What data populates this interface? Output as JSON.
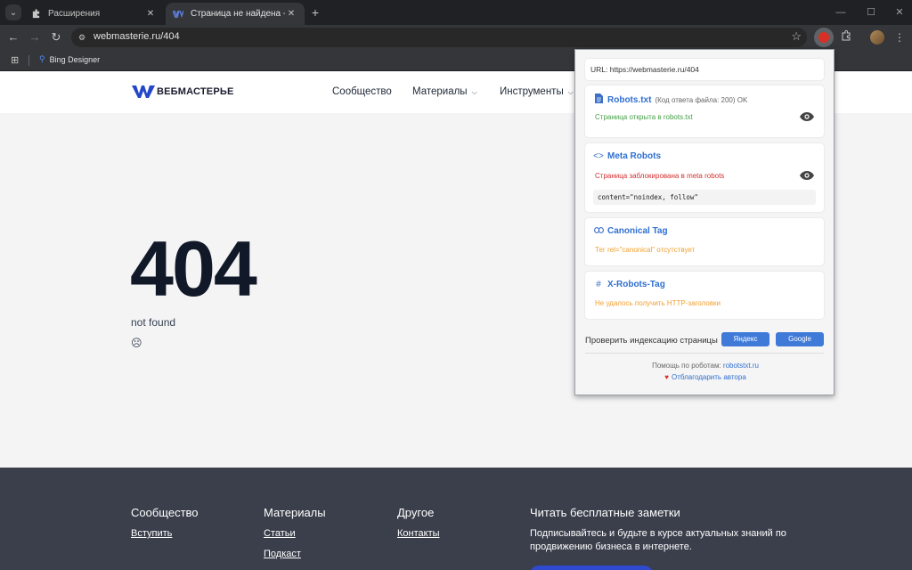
{
  "browser": {
    "tabs": [
      {
        "title": "Расширения",
        "icon": "puzzle-icon",
        "active": false
      },
      {
        "title": "Страница не найдена - Вебмастерье",
        "icon": "vm-favicon",
        "active": true
      }
    ],
    "omnibox": {
      "url": "webmasterie.ru/404"
    },
    "bookmarks": [
      {
        "label": "Bing Designer",
        "icon": "search-icon"
      }
    ],
    "toolbar_icons": [
      "back-icon",
      "forward-icon",
      "reload-icon",
      "site-info-icon",
      "bookmark-star-icon",
      "robots-extension-icon",
      "extensions-puzzle-icon",
      "profile-avatar",
      "menu-kebab-icon"
    ]
  },
  "site": {
    "logo_text": "ВЕБМАСТЕРЬЕ",
    "nav": [
      {
        "label": "Сообщество",
        "has_caret": false
      },
      {
        "label": "Материалы",
        "has_caret": true
      },
      {
        "label": "Инструменты",
        "has_caret": true
      }
    ],
    "error": {
      "code": "404",
      "text": "not found",
      "face": "☹"
    },
    "footer": {
      "columns": [
        {
          "title": "Сообщество",
          "links": [
            "Вступить"
          ]
        },
        {
          "title": "Материалы",
          "links": [
            "Статьи",
            "Подкаст"
          ]
        },
        {
          "title": "Другое",
          "links": [
            "Контакты"
          ]
        }
      ],
      "notes": {
        "title": "Читать бесплатные заметки",
        "text": "Подписывайтесь и будьте в курсе актуальных знаний по продвижению бизнеса в интернете."
      }
    }
  },
  "popup": {
    "url_line": "URL: https://webmasterie.ru/404",
    "robots": {
      "title": "Robots.txt",
      "meta": "(Код ответа файла: 200) OK",
      "status": "Страница открыта в robots.txt",
      "status_color": "#43a047"
    },
    "meta_robots": {
      "title": "Meta Robots",
      "status": "Страница заблокирована в meta robots",
      "status_color": "#d32f2f",
      "code": "content=\"noindex, follow\""
    },
    "canonical": {
      "title": "Canonical Tag",
      "status": "Тег rel=\"canonical\" отсутствует",
      "status_color": "#f0a030"
    },
    "x_robots": {
      "title": "X-Robots-Tag",
      "status": "Не удалось получить HTTP-заголовки",
      "status_color": "#f0a030"
    },
    "check": {
      "label": "Проверить индексацию страницы",
      "yandex": "Яндекс",
      "google": "Google"
    },
    "help": {
      "prefix": "Помощь по роботам:",
      "link": "robotstxt.ru"
    },
    "thanks": "Отблагодарить автора"
  }
}
